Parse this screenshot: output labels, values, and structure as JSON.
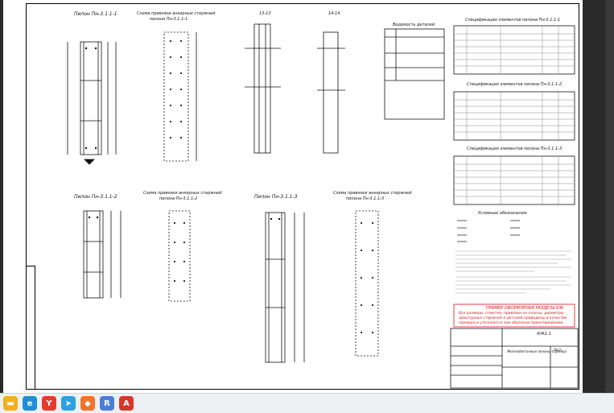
{
  "sheet": {
    "sections": {
      "pylon1_title": "Пилон Пн-3.1.1-1",
      "scheme1_title_l1": "Схема привязки анкерных стержней",
      "scheme1_title_l2": "пилона Пн-3.1.1-1",
      "section13": "13-13",
      "section14": "14-14",
      "pylon2_title": "Пилон Пн-3.1.1-2",
      "scheme2_title_l1": "Схема привязки анкерных стержней",
      "scheme2_title_l2": "пилона Пн-3.1.1-2",
      "pylon3_title": "Пилон Пн-3.1.1-3",
      "scheme3_title_l1": "Схема привязки анкерных стержней",
      "scheme3_title_l2": "пилона Пн-3.1.1-3"
    },
    "parts_list_title": "Ведомость деталей",
    "spec_titles": [
      "Спецификация элементов пилона Пн-3.1.1-1",
      "Спецификация элементов пилона Пн-3.1.1-2",
      "Спецификация элементов пилона Пн-3.1.1-3"
    ],
    "legend_title": "Условные обозначения",
    "notes_red_title": "ПРИМЕР ОФОРМЛЕНИЯ РАЗДЕЛА КЖ.",
    "notes_red_lines": [
      "Все размеры, отметки, привязки на планах, диаметры",
      "арматурных стержней и деталей приведены в качестве",
      "примера и уточняются при обрезном проектировании."
    ],
    "stamp": {
      "code": "-КЖ2.1",
      "name": "Железобетонные пилоны (пример)",
      "sheet_label": "Лист"
    }
  },
  "taskbar": {
    "icons": [
      {
        "name": "file-explorer-icon",
        "glyph": "▬",
        "color": "#f2b01e"
      },
      {
        "name": "edge-browser-icon",
        "glyph": "e",
        "color": "#1e8fd6"
      },
      {
        "name": "yandex-browser-icon",
        "glyph": "Y",
        "color": "#e63b2e"
      },
      {
        "name": "telegram-icon",
        "glyph": "➤",
        "color": "#2aa3e0"
      },
      {
        "name": "shield-app-icon",
        "glyph": "◆",
        "color": "#f0742d"
      },
      {
        "name": "r-app-icon",
        "glyph": "R",
        "color": "#4c7ed9"
      },
      {
        "name": "pdf-reader-icon",
        "glyph": "A",
        "color": "#d9342b"
      }
    ]
  }
}
